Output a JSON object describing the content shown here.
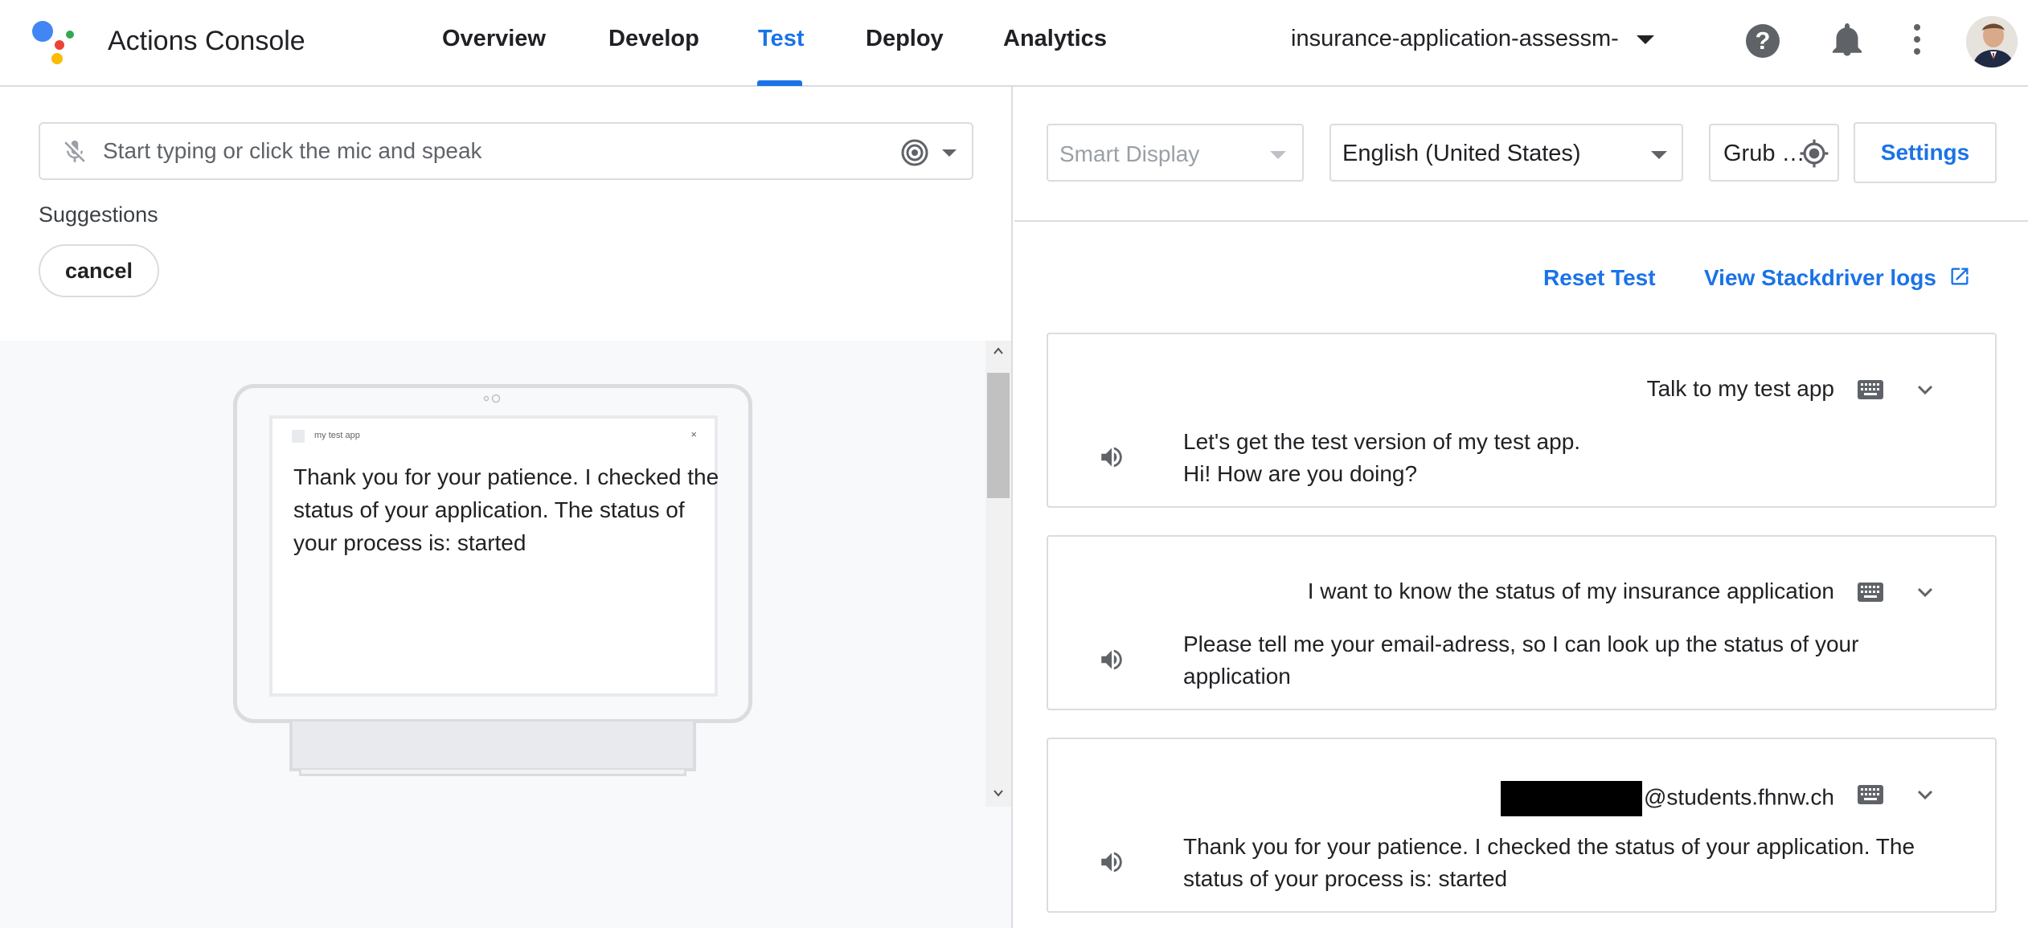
{
  "header": {
    "app_title": "Actions Console",
    "tabs": [
      {
        "label": "Overview",
        "active": false
      },
      {
        "label": "Develop",
        "active": false
      },
      {
        "label": "Test",
        "active": true
      },
      {
        "label": "Deploy",
        "active": false
      },
      {
        "label": "Analytics",
        "active": false
      }
    ],
    "project": "insurance-application-assessm-",
    "help_glyph": "?",
    "icons": [
      "google-logo",
      "help-icon",
      "notifications-icon",
      "more-vert-icon",
      "avatar"
    ],
    "accent_color": "#1a73e8"
  },
  "simulator": {
    "input_placeholder": "Start typing or click the mic and speak",
    "input_value": "",
    "suggestions_label": "Suggestions",
    "suggestions": [
      "cancel"
    ],
    "device": {
      "app_name": "my test app",
      "close_glyph": "×",
      "display_text": "Thank you for your patience. I checked the status of your application. The status of your process is: started"
    }
  },
  "controls": {
    "surface": "Smart Display",
    "language": "English (United States)",
    "location": "Grub …",
    "settings_label": "Settings",
    "reset_label": "Reset Test",
    "logs_label": "View Stackdriver logs"
  },
  "conversation": [
    {
      "user": "Talk to my test app",
      "agent_lines": [
        "Let's get the test version of my test app.",
        "Hi! How are you doing?"
      ]
    },
    {
      "user": "I want to know the status of my insurance application",
      "agent_lines": [
        "Please tell me your email-adress, so I can look up the status of your application"
      ]
    },
    {
      "user": "@students.fhnw.ch",
      "user_redacted": true,
      "agent_lines": [
        "Thank you for your patience. I checked the status of your application. The status of your process is: started"
      ]
    }
  ]
}
